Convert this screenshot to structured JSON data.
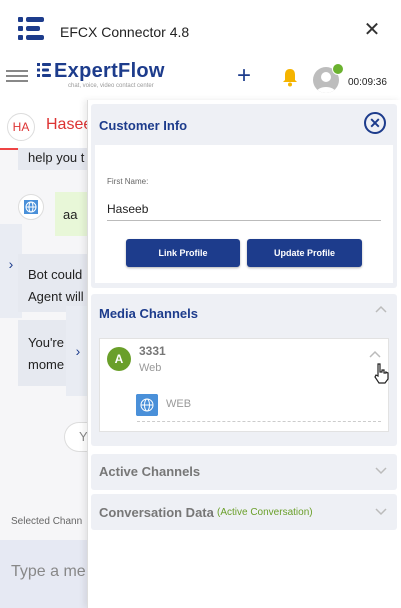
{
  "window": {
    "title": "EFCX Connector 4.8"
  },
  "header": {
    "logo_text": "ExpertFlow",
    "logo_tagline": "chat, voice, video contact center",
    "timer": "00:09:36"
  },
  "chat": {
    "contact_initials": "HA",
    "contact_name": "Hasee",
    "messages": [
      {
        "text": "help you t"
      },
      {
        "text": "aa"
      },
      {
        "text_line1": "Bot could",
        "text_line2": "Agent will"
      },
      {
        "text_line1": "You're",
        "text_line2": "mome"
      }
    ],
    "pill_text": "Y",
    "selected_channel_label": "Selected Chann",
    "input_placeholder": "Type a me"
  },
  "drawer": {
    "customer_info": {
      "title": "Customer Info",
      "first_name_label": "First Name:",
      "first_name_value": "Haseeb",
      "link_button": "Link Profile",
      "update_button": "Update Profile"
    },
    "media_channels": {
      "title": "Media Channels",
      "channel": {
        "avatar": "A",
        "identifier": "3331",
        "type": "Web",
        "sub_channel": "WEB"
      }
    },
    "active_channels": {
      "title": "Active Channels"
    },
    "conversation_data": {
      "title": "Conversation Data",
      "subtitle": "(Active Conversation)"
    }
  },
  "colors": {
    "brand": "#1d3c8c",
    "alert": "#d33333",
    "online": "#6bb22f"
  }
}
